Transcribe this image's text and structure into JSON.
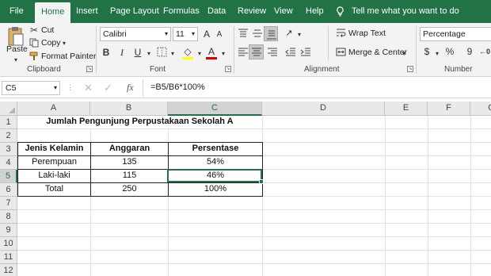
{
  "tabs": [
    "File",
    "Home",
    "Insert",
    "Page Layout",
    "Formulas",
    "Data",
    "Review",
    "View",
    "Help"
  ],
  "tell_me": "Tell me what you want to do",
  "clipboard": {
    "paste": "Paste",
    "cut": "Cut",
    "copy": "Copy",
    "format_painter": "Format Painter",
    "label": "Clipboard"
  },
  "font": {
    "name": "Calibri",
    "size": "11",
    "label": "Font",
    "bold": "B",
    "italic": "I",
    "underline": "U",
    "grow": "A",
    "shrink": "A",
    "color_letter": "A"
  },
  "alignment": {
    "wrap": "Wrap Text",
    "merge": "Merge & Center",
    "label": "Alignment"
  },
  "number": {
    "format": "Percentage",
    "label": "Number",
    "currency": "$",
    "percent": "%",
    "comma": "9"
  },
  "formula_bar": {
    "name_box": "C5",
    "fx": "fx",
    "formula": "=B5/B6*100%"
  },
  "accent": "#217346",
  "columns": [
    "A",
    "B",
    "C",
    "D",
    "E",
    "F",
    "G"
  ],
  "rows": [
    "1",
    "2",
    "3",
    "4",
    "5",
    "6",
    "7",
    "8",
    "9",
    "10",
    "11",
    "12"
  ],
  "sheet": {
    "title": "Jumlah Pengunjung Perpustakaan Sekolah A",
    "headers": [
      "Jenis Kelamin",
      "Anggaran",
      "Persentase"
    ],
    "data": [
      [
        "Perempuan",
        "135",
        "54%"
      ],
      [
        "Laki-laki",
        "115",
        "46%"
      ],
      [
        "Total",
        "250",
        "100%"
      ]
    ]
  }
}
